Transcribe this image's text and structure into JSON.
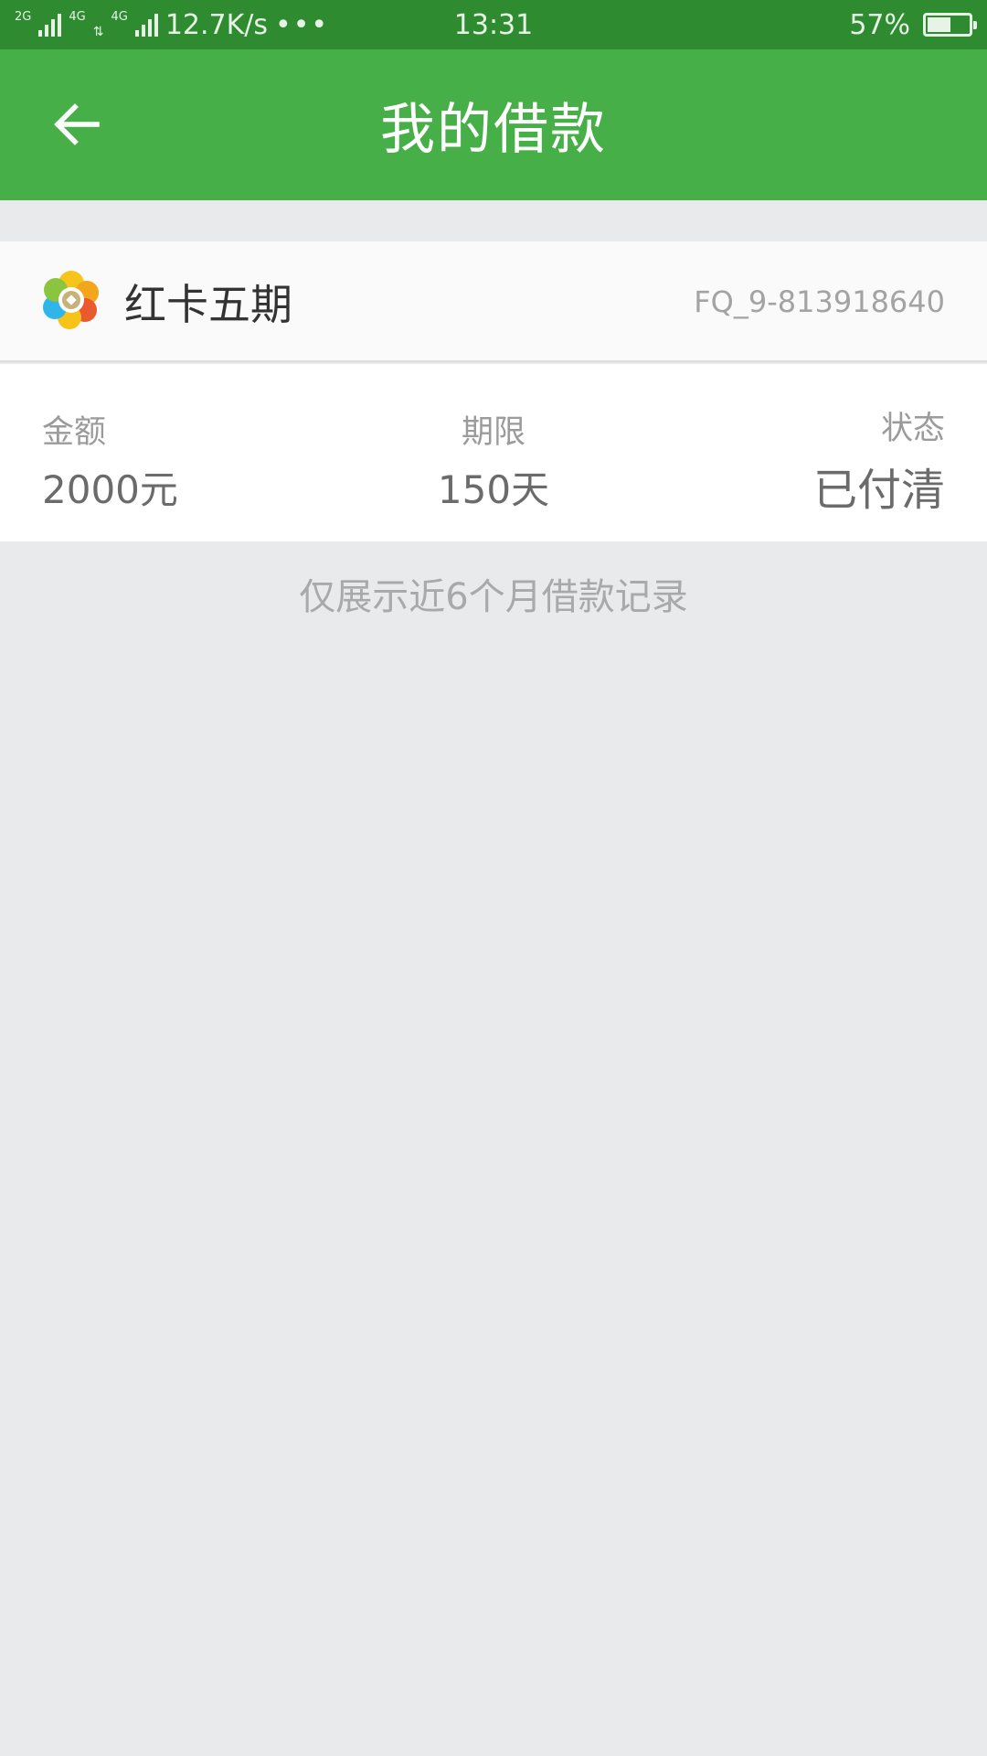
{
  "status_bar": {
    "network_2g": "2G",
    "network_4g_a": "4G",
    "network_4g_b": "4G",
    "speed": "12.7K/s",
    "more": "•••",
    "time": "13:31",
    "battery_percent": "57%",
    "battery_level": 0.57
  },
  "app_bar": {
    "title": "我的借款",
    "back_icon": "arrow-left-icon"
  },
  "loan": {
    "logo_icon": "pinwheel-coin-logo",
    "product_name": "红卡五期",
    "loan_no": "FQ_9-813918640",
    "amount_label": "金额",
    "amount_value": "2000元",
    "term_label": "期限",
    "term_value": "150天",
    "status_label": "状态",
    "status_value": "已付清"
  },
  "footer_note": "仅展示近6个月借款记录",
  "colors": {
    "status_bar": "#2e8b30",
    "app_bar": "#46af48",
    "background": "#e9eaec"
  }
}
